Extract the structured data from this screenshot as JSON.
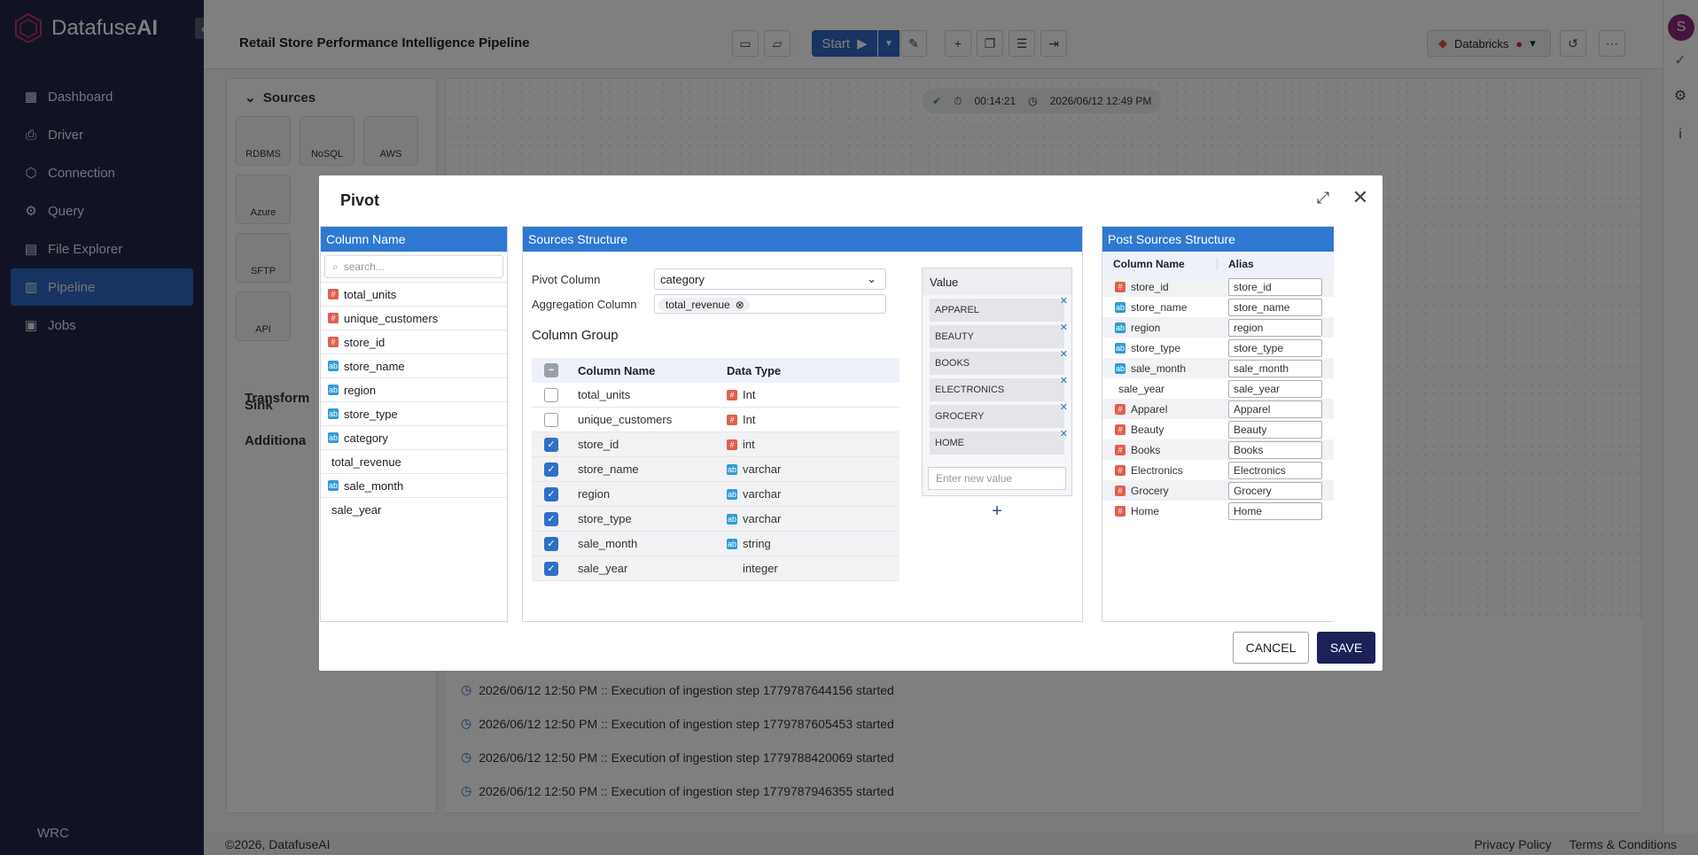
{
  "app": {
    "brand_prefix": "Datafuse",
    "brand_suffix": "AI",
    "workspace": "WRC",
    "avatar_initial": "S"
  },
  "sidebar": {
    "items": [
      {
        "label": "Dashboard",
        "icon": "dashboard-icon"
      },
      {
        "label": "Driver",
        "icon": "driver-icon"
      },
      {
        "label": "Connection",
        "icon": "connection-icon"
      },
      {
        "label": "Query",
        "icon": "query-icon"
      },
      {
        "label": "File Explorer",
        "icon": "file-explorer-icon"
      },
      {
        "label": "Pipeline",
        "icon": "pipeline-icon",
        "active": true
      },
      {
        "label": "Jobs",
        "icon": "jobs-icon"
      }
    ]
  },
  "header": {
    "title": "Retail Store Performance Intelligence Pipeline",
    "start_label": "Start",
    "engine": "Databricks"
  },
  "sources_panel": {
    "title": "Sources",
    "tiles": [
      "RDBMS",
      "NoSQL",
      "AWS",
      "Azure",
      "SFTP",
      "API"
    ],
    "sections": [
      "Transform",
      "Sink",
      "Additiona"
    ]
  },
  "run": {
    "duration": "00:14:21",
    "timestamp": "2026/06/12 12:49 PM"
  },
  "logs": [
    "2026/06/12 12:50 PM :: Execution of ingestion step 1779787644156 started",
    "2026/06/12 12:50 PM :: Execution of ingestion step 1779787605453 started",
    "2026/06/12 12:50 PM :: Execution of ingestion step 1779788420069 started",
    "2026/06/12 12:50 PM :: Execution of ingestion step 1779787946355 started"
  ],
  "footer": {
    "copyright": "©2026, DatafuseAI",
    "privacy": "Privacy Policy",
    "terms": "Terms & Conditions"
  },
  "modal": {
    "title": "Pivot",
    "column_list": {
      "header": "Column Name",
      "search_placeholder": "search...",
      "items": [
        {
          "name": "total_units",
          "type": "num"
        },
        {
          "name": "unique_customers",
          "type": "num"
        },
        {
          "name": "store_id",
          "type": "num"
        },
        {
          "name": "store_name",
          "type": "str"
        },
        {
          "name": "region",
          "type": "str"
        },
        {
          "name": "store_type",
          "type": "str"
        },
        {
          "name": "category",
          "type": "str"
        },
        {
          "name": "total_revenue",
          "type": ""
        },
        {
          "name": "sale_month",
          "type": "str"
        },
        {
          "name": "sale_year",
          "type": ""
        }
      ]
    },
    "sources": {
      "header": "Sources Structure",
      "pivot_label": "Pivot Column",
      "pivot_value": "category",
      "agg_label": "Aggregation Column",
      "agg_value": "total_revenue",
      "group_title": "Column Group",
      "col_header": "Column Name",
      "type_header": "Data Type",
      "rows": [
        {
          "name": "total_units",
          "type": "Int",
          "checked": false,
          "icon": "num"
        },
        {
          "name": "unique_customers",
          "type": "Int",
          "checked": false,
          "icon": "num"
        },
        {
          "name": "store_id",
          "type": "int",
          "checked": true,
          "icon": "num"
        },
        {
          "name": "store_name",
          "type": "varchar",
          "checked": true,
          "icon": "str"
        },
        {
          "name": "region",
          "type": "varchar",
          "checked": true,
          "icon": "str"
        },
        {
          "name": "store_type",
          "type": "varchar",
          "checked": true,
          "icon": "str"
        },
        {
          "name": "sale_month",
          "type": "string",
          "checked": true,
          "icon": "str"
        },
        {
          "name": "sale_year",
          "type": "integer",
          "checked": true,
          "icon": ""
        }
      ],
      "value_header": "Value",
      "values": [
        "APPAREL",
        "BEAUTY",
        "BOOKS",
        "ELECTRONICS",
        "GROCERY",
        "HOME"
      ],
      "value_placeholder": "Enter new value"
    },
    "post": {
      "header": "Post Sources Structure",
      "col_header": "Column Name",
      "alias_header": "Alias",
      "rows": [
        {
          "name": "store_id",
          "alias": "store_id",
          "icon": "num"
        },
        {
          "name": "store_name",
          "alias": "store_name",
          "icon": "str"
        },
        {
          "name": "region",
          "alias": "region",
          "icon": "str"
        },
        {
          "name": "store_type",
          "alias": "store_type",
          "icon": "str"
        },
        {
          "name": "sale_month",
          "alias": "sale_month",
          "icon": "str"
        },
        {
          "name": "sale_year",
          "alias": "sale_year",
          "icon": ""
        },
        {
          "name": "Apparel",
          "alias": "Apparel",
          "icon": "num"
        },
        {
          "name": "Beauty",
          "alias": "Beauty",
          "icon": "num"
        },
        {
          "name": "Books",
          "alias": "Books",
          "icon": "num"
        },
        {
          "name": "Electronics",
          "alias": "Electronics",
          "icon": "num"
        },
        {
          "name": "Grocery",
          "alias": "Grocery",
          "icon": "num"
        },
        {
          "name": "Home",
          "alias": "Home",
          "icon": "num"
        }
      ]
    },
    "cancel_label": "CANCEL",
    "save_label": "SAVE"
  }
}
